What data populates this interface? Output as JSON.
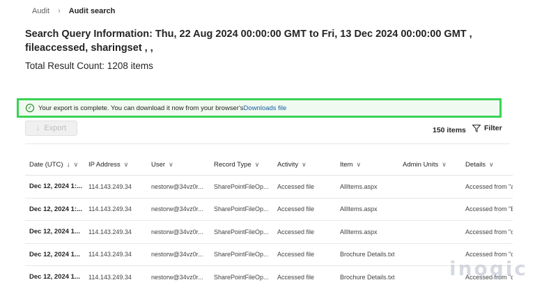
{
  "breadcrumb": {
    "root": "Audit",
    "current": "Audit search"
  },
  "query": {
    "title": "Search Query Information: Thu, 22 Aug 2024 00:00:00 GMT to Fri, 13 Dec 2024 00:00:00 GMT , fileaccessed, sharingset , ,",
    "total": "Total Result Count: 1208 items"
  },
  "banner": {
    "text": "Your export is complete. You can download it now from your browser's",
    "link": "Downloads file"
  },
  "toolbar": {
    "export_label": "Export",
    "items_count": "150 items",
    "filter_label": "Filter"
  },
  "table": {
    "headers": [
      "Date (UTC)",
      "IP Address",
      "User",
      "Record Type",
      "Activity",
      "Item",
      "Admin Units",
      "Details"
    ],
    "rows": [
      [
        "Dec 12, 2024 1:...",
        "114.143.249.34",
        "nestorw@34vz0r...",
        "SharePointFileOp...",
        "Accessed file",
        "AllItems.aspx",
        "",
        "Accessed from \"a..."
      ],
      [
        "Dec 12, 2024 1:...",
        "114.143.249.34",
        "nestorw@34vz0r...",
        "SharePointFileOp...",
        "Accessed file",
        "AllItems.aspx",
        "",
        "Accessed from \"E..."
      ],
      [
        "Dec 12, 2024 1...",
        "114.143.249.34",
        "nestorw@34vz0r...",
        "SharePointFileOp...",
        "Accessed file",
        "AllItems.aspx",
        "",
        "Accessed from \"cr..."
      ],
      [
        "Dec 12, 2024 1...",
        "114.143.249.34",
        "nestorw@34vz0r...",
        "SharePointFileOp...",
        "Accessed file",
        "Brochure Details.txt",
        "",
        "Accessed from \"cr..."
      ],
      [
        "Dec 12, 2024 1...",
        "114.143.249.34",
        "nestorw@34vz0r...",
        "SharePointFileOp...",
        "Accessed file",
        "Brochure Details.txt",
        "",
        "Accessed from \"cr..."
      ]
    ]
  },
  "watermark": "inogic",
  "colors": {
    "banner_border": "#39d353",
    "link": "#115ea3",
    "success": "#107c10"
  }
}
